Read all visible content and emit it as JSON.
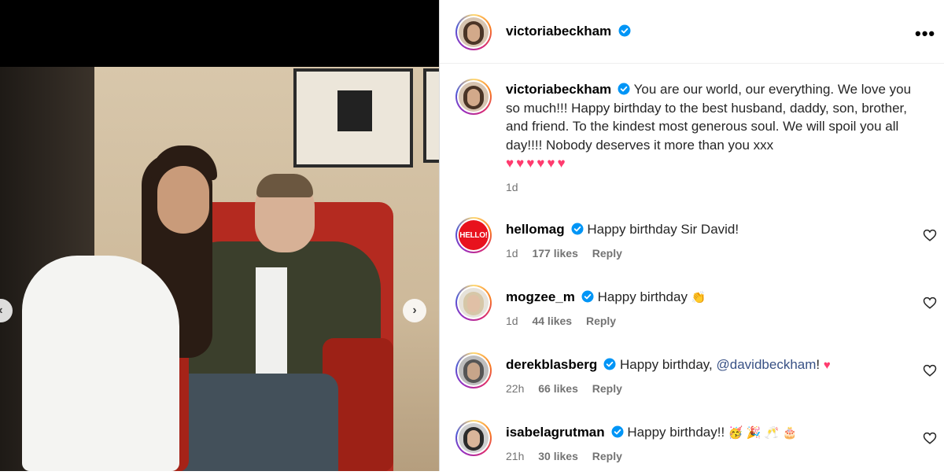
{
  "post": {
    "username": "victoriabeckham",
    "more_label": "•••"
  },
  "caption": {
    "username": "victoriabeckham",
    "text": "You are our world, our everything. We love you so much!!! Happy birthday to the best husband, daddy, son, brother, and friend. To the kindest most generous soul. We will spoil you all day!!!! Nobody deserves it more than you xxx",
    "hearts": "♥♥♥♥♥♥",
    "time": "1d"
  },
  "comments": [
    {
      "username": "hellomag",
      "avatar_text": "HELLO!",
      "text": "Happy birthday Sir David!",
      "time": "1d",
      "likes": "177 likes",
      "reply": "Reply"
    },
    {
      "username": "mogzee_m",
      "text": "Happy birthday",
      "emoji": "👏",
      "time": "1d",
      "likes": "44 likes",
      "reply": "Reply"
    },
    {
      "username": "derekblasberg",
      "text": "Happy birthday,",
      "mention": "@davidbeckham",
      "after": "!",
      "emoji": "♥",
      "time": "22h",
      "likes": "66 likes",
      "reply": "Reply"
    },
    {
      "username": "isabelagrutman",
      "text": "Happy birthday!!",
      "emoji": "🥳 🎉 🥂 🎂",
      "time": "21h",
      "likes": "30 likes",
      "reply": "Reply"
    }
  ],
  "colors": {
    "verified": "#0095f6",
    "heart": "#ff3b6e",
    "mention": "#385185",
    "meta": "#737373"
  }
}
